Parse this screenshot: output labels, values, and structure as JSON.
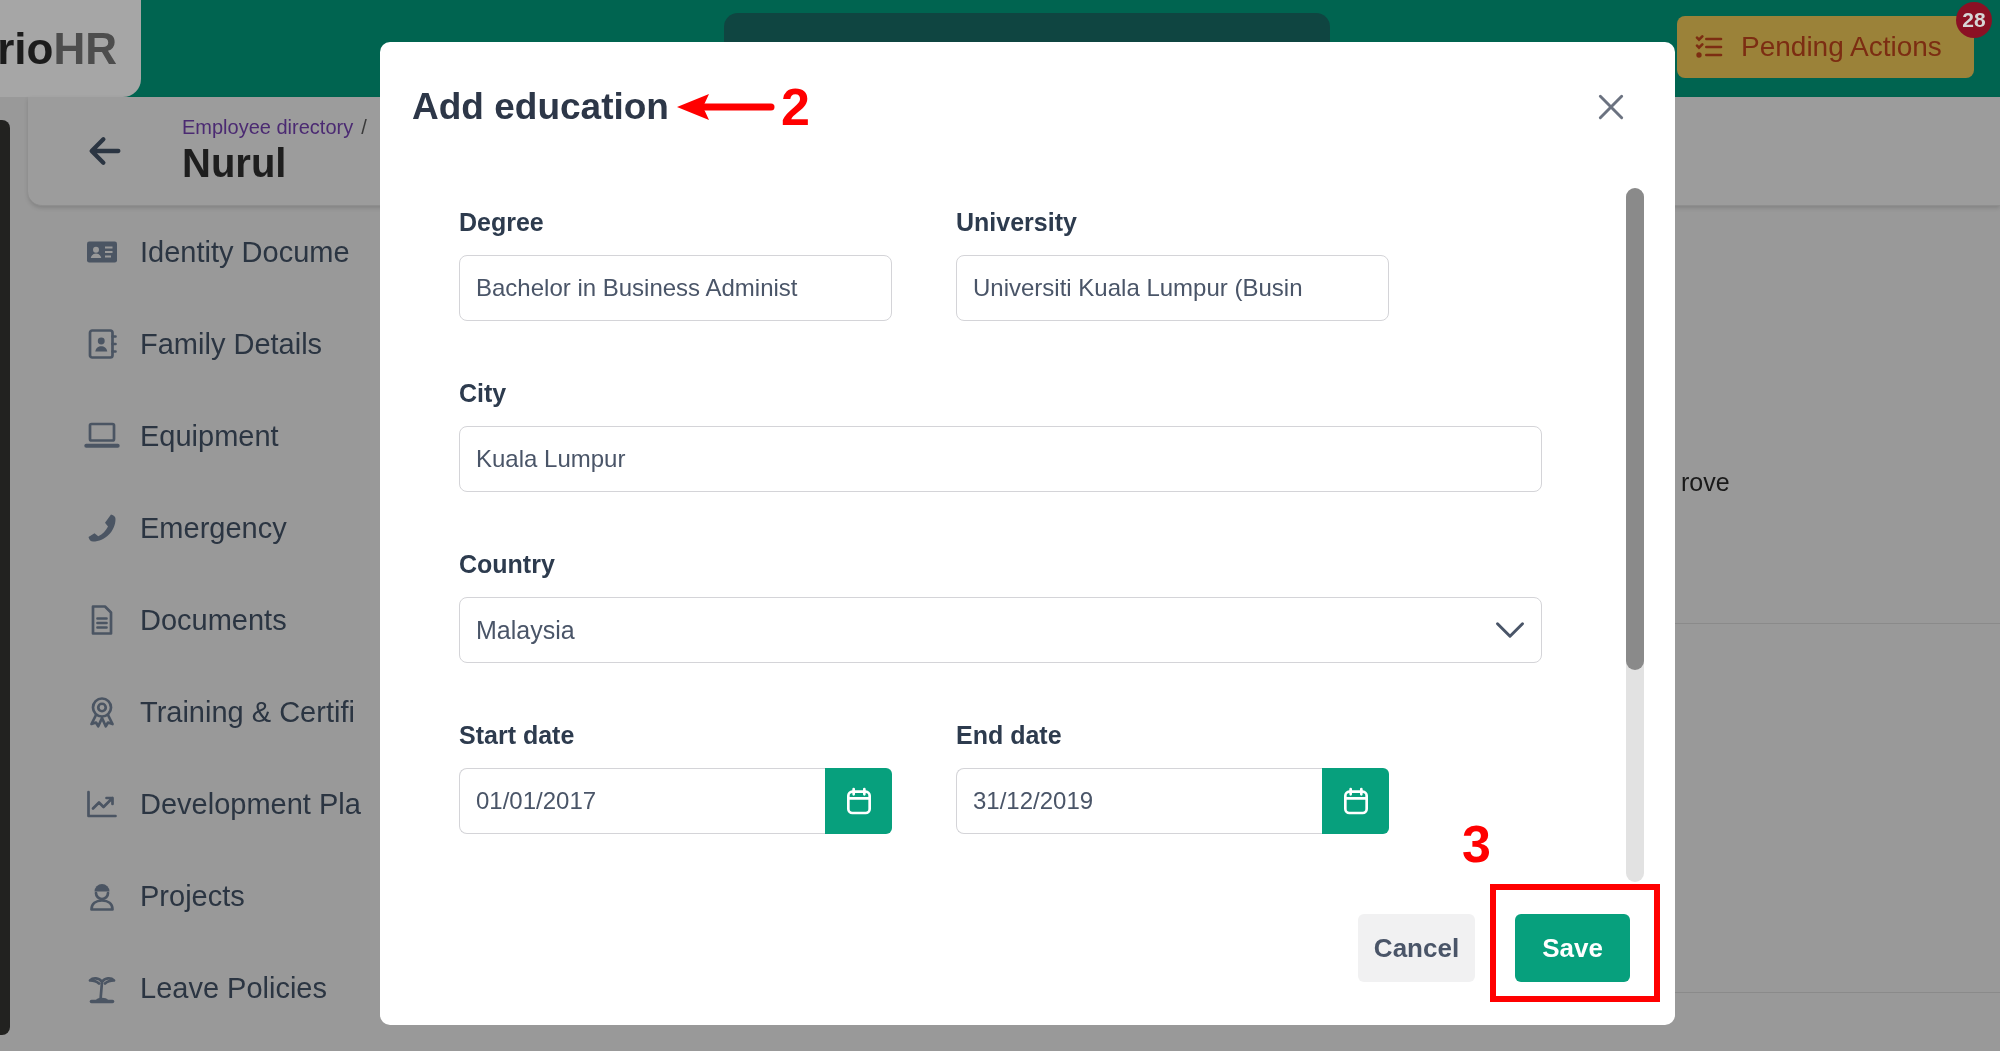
{
  "top_bar": {
    "logo": {
      "main": "rio",
      "suffix": "HR"
    },
    "pending_actions": {
      "label": "Pending Actions",
      "badge": "28"
    }
  },
  "page_header": {
    "breadcrumb": "Employee directory",
    "separator": "/",
    "title": "Nurul"
  },
  "sidebar": {
    "items": [
      {
        "label": "Identity Docume"
      },
      {
        "label": "Family Details"
      },
      {
        "label": "Equipment"
      },
      {
        "label": "Emergency"
      },
      {
        "label": "Documents"
      },
      {
        "label": "Training & Certifi"
      },
      {
        "label": "Development Pla"
      },
      {
        "label": "Projects"
      },
      {
        "label": "Leave Policies"
      }
    ]
  },
  "content": {
    "text": "rove"
  },
  "dialog": {
    "title": "Add education",
    "rows": [
      [
        {
          "kind": "text",
          "label": "Degree",
          "value": "Bachelor in Business Administ"
        },
        {
          "kind": "text",
          "label": "University",
          "value": "Universiti Kuala Lumpur (Busin"
        }
      ],
      [
        {
          "kind": "text",
          "label": "City",
          "value": "Kuala Lumpur"
        }
      ],
      [
        {
          "kind": "select",
          "label": "Country",
          "value": "Malaysia"
        }
      ],
      [
        {
          "kind": "date",
          "label": "Start date",
          "value": "01/01/2017"
        },
        {
          "kind": "date",
          "label": "End date",
          "value": "31/12/2019"
        }
      ]
    ],
    "buttons": [
      {
        "kind": "secondary",
        "label": "Cancel"
      },
      {
        "kind": "primary",
        "label": "Save"
      }
    ]
  },
  "annotations": [
    {
      "kind": "arrow",
      "label": "2"
    },
    {
      "kind": "box",
      "label": "3"
    }
  ]
}
